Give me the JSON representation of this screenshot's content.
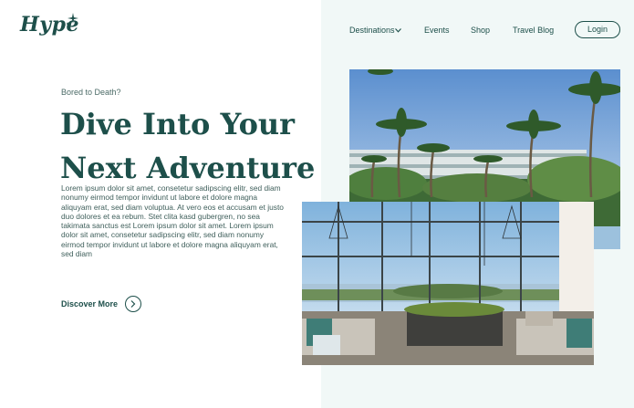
{
  "brand": {
    "logo_text": "Hype"
  },
  "nav": {
    "destinations": "Destinations",
    "events": "Events",
    "shop": "Shop",
    "blog": "Travel Blog",
    "login": "Login"
  },
  "hero": {
    "eyebrow": "Bored to Death?",
    "title_line1": "Dive Into Your",
    "title_line2": "Next Adventure",
    "body": "Lorem ipsum dolor sit amet, consetetur sadipscing elitr, sed diam nonumy eirmod tempor invidunt ut labore et dolore magna aliquyam erat, sed diam voluptua. At vero eos et accusam et justo duo dolores et ea rebum. Stet clita kasd gubergren, no sea takimata sanctus est Lorem ipsum dolor sit amet. Lorem ipsum dolor sit amet, consetetur sadipscing elitr, sed diam nonumy eirmod tempor invidunt ut labore et dolore magna aliquyam erat, sed diam",
    "cta": "Discover More"
  },
  "colors": {
    "brand": "#1d4f4a",
    "panel_bg": "#f1f8f7",
    "body_text": "#3f5f5b"
  },
  "icons": {
    "logo_sparkle": "sparkle-icon",
    "dropdown": "chevron-down-icon",
    "cta_arrow": "chevron-right-icon"
  }
}
